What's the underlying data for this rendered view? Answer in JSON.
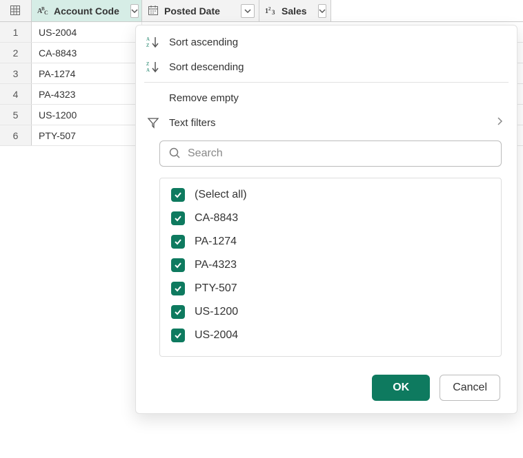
{
  "columns": [
    {
      "name": "Account Code",
      "type": "text",
      "active": true
    },
    {
      "name": "Posted Date",
      "type": "date",
      "active": false
    },
    {
      "name": "Sales",
      "type": "number",
      "active": false
    }
  ],
  "rows": [
    {
      "n": "1",
      "account_code": "US-2004"
    },
    {
      "n": "2",
      "account_code": "CA-8843"
    },
    {
      "n": "3",
      "account_code": "PA-1274"
    },
    {
      "n": "4",
      "account_code": "PA-4323"
    },
    {
      "n": "5",
      "account_code": "US-1200"
    },
    {
      "n": "6",
      "account_code": "PTY-507"
    }
  ],
  "menu": {
    "sort_asc": "Sort ascending",
    "sort_desc": "Sort descending",
    "remove_empty": "Remove empty",
    "text_filters": "Text filters"
  },
  "search": {
    "placeholder": "Search"
  },
  "filter_values": [
    {
      "label": "(Select all)",
      "checked": true
    },
    {
      "label": "CA-8843",
      "checked": true
    },
    {
      "label": "PA-1274",
      "checked": true
    },
    {
      "label": "PA-4323",
      "checked": true
    },
    {
      "label": "PTY-507",
      "checked": true
    },
    {
      "label": "US-1200",
      "checked": true
    },
    {
      "label": "US-2004",
      "checked": true
    }
  ],
  "buttons": {
    "ok": "OK",
    "cancel": "Cancel"
  },
  "colors": {
    "accent": "#0e7a5f"
  }
}
